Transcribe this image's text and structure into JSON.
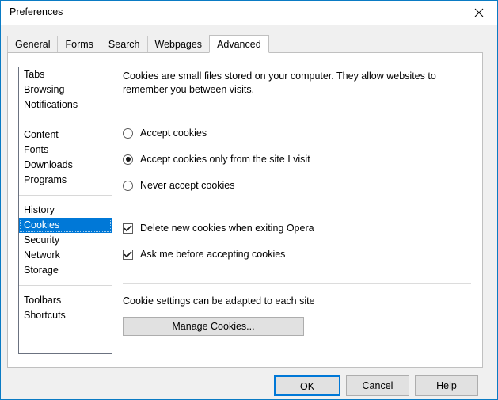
{
  "window": {
    "title": "Preferences",
    "close_icon": "close-icon",
    "accent_color": "#0078d7",
    "border_color": "#0a7bc4"
  },
  "tabs": [
    {
      "label": "General",
      "active": false
    },
    {
      "label": "Forms",
      "active": false
    },
    {
      "label": "Search",
      "active": false
    },
    {
      "label": "Webpages",
      "active": false
    },
    {
      "label": "Advanced",
      "active": true
    }
  ],
  "sidebar": {
    "selected": "Cookies",
    "groups": [
      {
        "items": [
          {
            "label": "Tabs"
          },
          {
            "label": "Browsing"
          },
          {
            "label": "Notifications"
          }
        ]
      },
      {
        "items": [
          {
            "label": "Content"
          },
          {
            "label": "Fonts"
          },
          {
            "label": "Downloads"
          },
          {
            "label": "Programs"
          }
        ]
      },
      {
        "items": [
          {
            "label": "History"
          },
          {
            "label": "Cookies"
          },
          {
            "label": "Security"
          },
          {
            "label": "Network"
          },
          {
            "label": "Storage"
          }
        ]
      },
      {
        "items": [
          {
            "label": "Toolbars"
          },
          {
            "label": "Shortcuts"
          }
        ]
      }
    ]
  },
  "content": {
    "intro": "Cookies are small files stored on your computer. They allow websites to remember you between visits.",
    "radios": [
      {
        "label": "Accept cookies",
        "checked": false
      },
      {
        "label": "Accept cookies only from the site I visit",
        "checked": true
      },
      {
        "label": "Never accept cookies",
        "checked": false
      }
    ],
    "checkboxes": [
      {
        "label": "Delete new cookies when exiting Opera",
        "checked": true
      },
      {
        "label": "Ask me before accepting cookies",
        "checked": true
      }
    ],
    "sub_note": "Cookie settings can be adapted to each site",
    "manage_button": "Manage Cookies..."
  },
  "footer": {
    "ok": "OK",
    "cancel": "Cancel",
    "help": "Help"
  }
}
